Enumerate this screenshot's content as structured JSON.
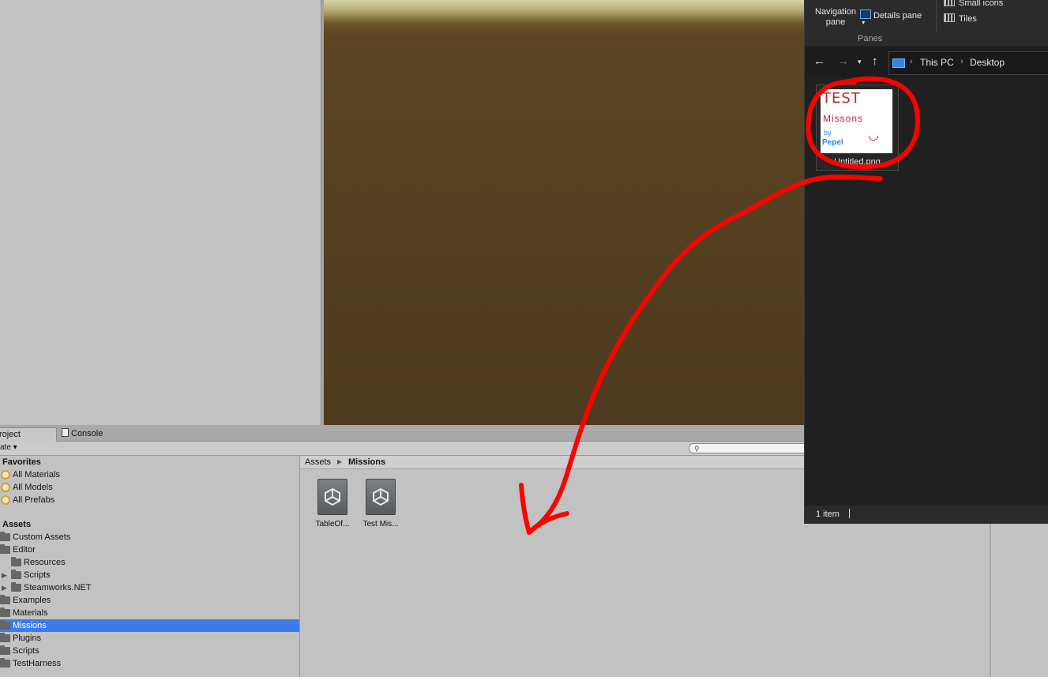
{
  "unity": {
    "tabs": [
      {
        "label": "roject"
      },
      {
        "label": "Console"
      }
    ],
    "toolbar": {
      "create_label": "ate ▾"
    },
    "tree": {
      "favorites_header": "Favorites",
      "favorites": [
        "All Materials",
        "All Models",
        "All Prefabs"
      ],
      "assets_header": "Assets",
      "items": [
        {
          "label": "Custom Assets",
          "depth": 0
        },
        {
          "label": "Editor",
          "depth": 0
        },
        {
          "label": "Resources",
          "depth": 1
        },
        {
          "label": "Scripts",
          "depth": 1,
          "expandable": true
        },
        {
          "label": "Steamworks.NET",
          "depth": 1,
          "expandable": true
        },
        {
          "label": "Examples",
          "depth": 0
        },
        {
          "label": "Materials",
          "depth": 0
        },
        {
          "label": "Missions",
          "depth": 0,
          "selected": true
        },
        {
          "label": "Plugins",
          "depth": 0
        },
        {
          "label": "Scripts",
          "depth": 0
        },
        {
          "label": "TestHarness",
          "depth": 0
        }
      ]
    },
    "breadcrumb": {
      "root": "Assets",
      "current": "Missions"
    },
    "assets": [
      {
        "label": "TableOf..."
      },
      {
        "label": "Test Mis..."
      }
    ],
    "colors": {
      "selection": "#3d7ce8",
      "panel": "#c2c2c2"
    }
  },
  "explorer": {
    "ribbon": {
      "navigation_pane": "Navigation pane",
      "details_pane": "Details pane",
      "group_label": "Panes",
      "small_icons": "Small icons",
      "tiles": "Tiles"
    },
    "address": {
      "parts": [
        "This PC",
        "Desktop"
      ]
    },
    "file": {
      "name": "Untitled.png",
      "thumbnail_text": [
        "TEST",
        "Missons",
        "by",
        "Pepel"
      ]
    },
    "status": {
      "count": "1 item"
    },
    "colors": {
      "background": "#202020",
      "accent": "#2e8ae6"
    }
  },
  "annotation": {
    "color": "#ff0000",
    "shape": "circle-and-arrow"
  }
}
